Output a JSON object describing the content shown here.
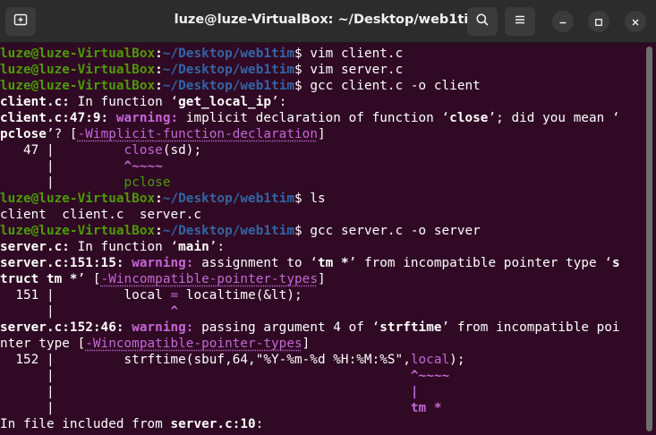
{
  "window": {
    "title": "luze@luze-VirtualBox: ~/Desktop/web1tim",
    "colors": {
      "background": "#300a24",
      "titlebar": "#2c2c2c",
      "prompt_user": "#4e9a06",
      "prompt_path": "#3465a4",
      "warning": "#c467d6"
    }
  },
  "prompt": {
    "user_host": "luze@luze-VirtualBox",
    "colon": ":",
    "path": "~/Desktop/web1tim",
    "dollar": "$"
  },
  "terminal": {
    "lines": [
      {
        "cmd": " vim client.c"
      },
      {
        "cmd": " vim server.c"
      },
      {
        "cmd": " gcc client.c -o client"
      },
      {
        "file": "client.c:",
        "rest": " In function ",
        "q1": "‘",
        "fn": "get_local_ip",
        "q2": "’:"
      },
      {
        "loc": "client.c:47:9:",
        "warn": " warning:",
        "a": " implicit declaration of function ",
        "q1": "‘",
        "fn": "close",
        "b": "’; did you mean ‘"
      },
      {
        "fn": "pclose",
        "a": "’? [",
        "flag": "-Wimplicit-function-declaration",
        "b": "]"
      },
      {
        "num": "   47 |",
        "pad": "         ",
        "hl": "close",
        "rest": "(sd);"
      },
      {
        "bar": "      |",
        "pad": "         ",
        "hl": "^~~~~"
      },
      {
        "bar": "      |",
        "pad": "         ",
        "sugg": "pclose"
      },
      {
        "cmd": " ls"
      },
      {
        "text": "client  client.c  server.c"
      },
      {
        "cmd": " gcc server.c -o server"
      },
      {
        "file": "server.c:",
        "rest": " In function ",
        "q1": "‘",
        "fn": "main",
        "q2": "’:"
      },
      {
        "loc": "server.c:151:15:",
        "warn": " warning:",
        "a": " assignment to ",
        "q1": "‘",
        "fn": "tm *",
        "b": "’ from incompatible pointer type ‘",
        "c": "s"
      },
      {
        "fn": "truct tm *",
        "a": "’ [",
        "flag": "-Wincompatible-pointer-types",
        "b": "]"
      },
      {
        "num": "  151 |",
        "pad": "         local ",
        "hl": "=",
        "rest": " localtime(&lt);"
      },
      {
        "bar": "      |",
        "pad": "               ",
        "hl": "^"
      },
      {
        "loc": "server.c:152:46:",
        "warn": " warning:",
        "a": " passing argument 4 of ",
        "q1": "‘",
        "fn": "strftime",
        "b": "’ from incompatible poi"
      },
      {
        "a": "nter type [",
        "flag": "-Wincompatible-pointer-types",
        "b": "]"
      },
      {
        "num": "  152 |",
        "pad": "         strftime(sbuf,64,\"%Y-%m-%d %H:%M:%S\",",
        "hl": "local",
        "rest": ");"
      },
      {
        "bar": "      |",
        "pad": "                                              ",
        "hl": "^~~~~"
      },
      {
        "bar": "      |",
        "pad": "                                              ",
        "hl": "|"
      },
      {
        "bar": "      |",
        "pad": "                                              ",
        "hl": "tm *"
      },
      {
        "a": "In file included from ",
        "fn": "server.c:10",
        "b": ":"
      }
    ]
  }
}
